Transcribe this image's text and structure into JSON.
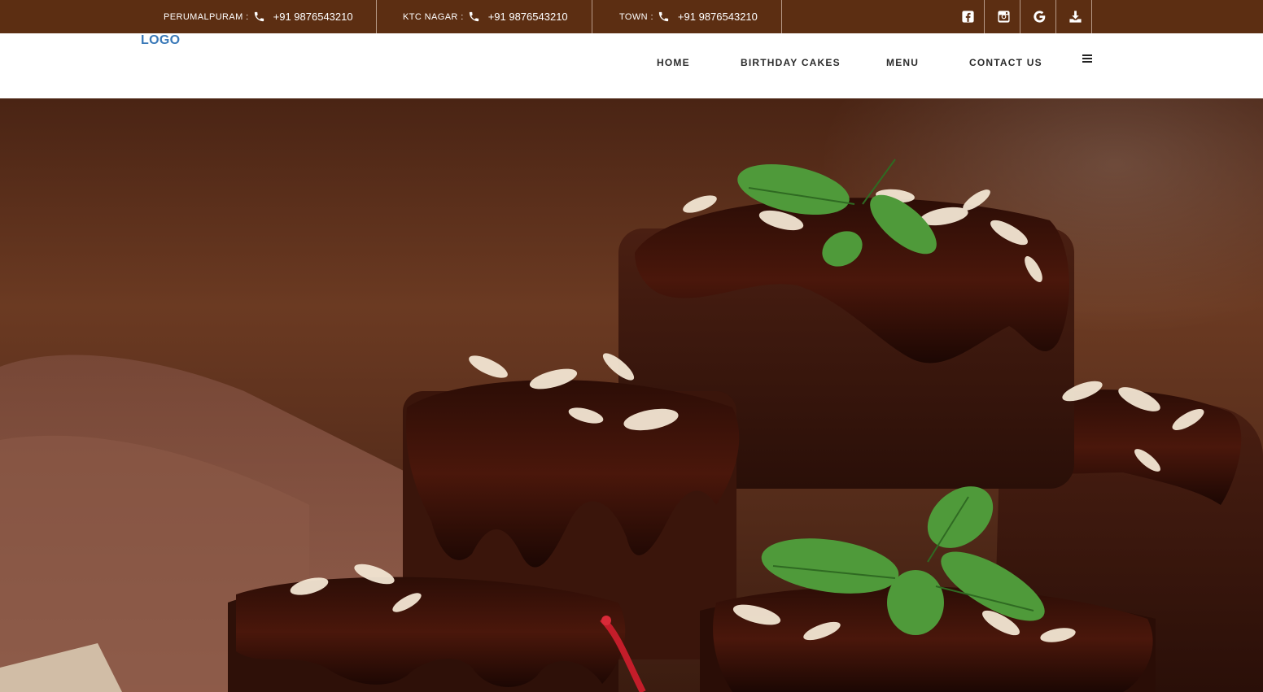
{
  "topbar": {
    "contacts": [
      {
        "label": "PERUMALPURAM :",
        "phone": "+91 9876543210"
      },
      {
        "label": "KTC NAGAR :",
        "phone": "+91 9876543210"
      },
      {
        "label": "TOWN :",
        "phone": "+91 9876543210"
      }
    ],
    "social": [
      "facebook-icon",
      "instagram-icon",
      "google-icon",
      "download-icon"
    ]
  },
  "header": {
    "logo": "LOGO",
    "nav": [
      "HOME",
      "BIRTHDAY CAKES",
      "MENU",
      "CONTACT US"
    ],
    "menu_icon": "hamburger-icon"
  },
  "hero": {
    "image": "chocolate brownies with almond flakes and mint"
  },
  "colors": {
    "topbar_bg": "#5c2e12",
    "logo": "#3a79b8",
    "nav_text": "#2b2b2b"
  }
}
